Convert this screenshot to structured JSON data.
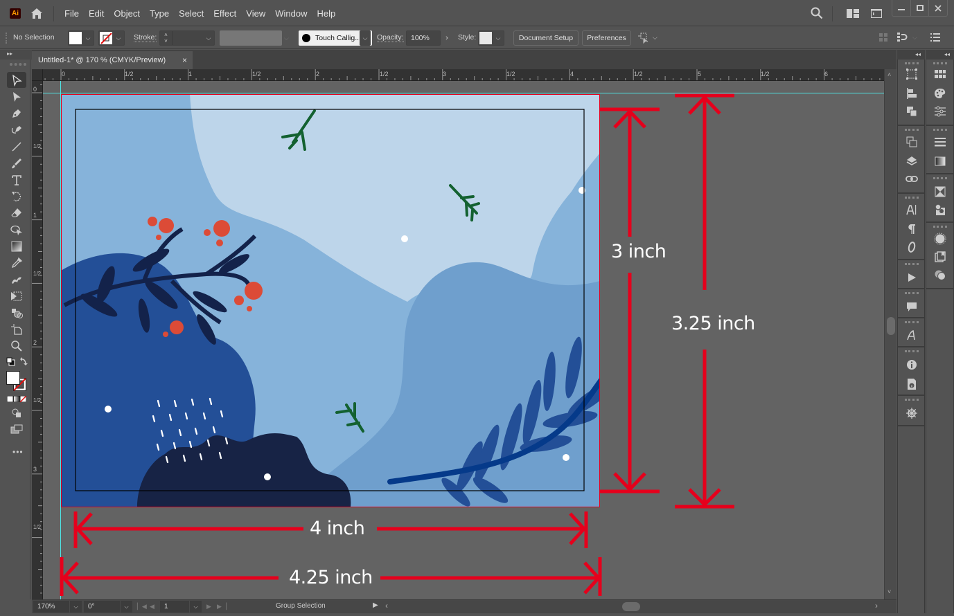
{
  "app": {
    "logo": "Ai",
    "menu": [
      "File",
      "Edit",
      "Object",
      "Type",
      "Select",
      "Effect",
      "View",
      "Window",
      "Help"
    ]
  },
  "control_bar": {
    "selection_status": "No Selection",
    "stroke_label": "Stroke:",
    "brush_name": "Touch Callig...",
    "opacity_label": "Opacity:",
    "opacity_value": "100%",
    "style_label": "Style:",
    "document_setup": "Document Setup",
    "preferences": "Preferences"
  },
  "document": {
    "tab_title": "Untitled-1* @ 170 % (CMYK/Preview)",
    "close_glyph": "×"
  },
  "rulers": {
    "top_labels": [
      "0",
      "1/2",
      "1",
      "1/2",
      "2",
      "1/2",
      "3",
      "1/2",
      "4",
      "1/2",
      "5",
      "1/2",
      "6"
    ],
    "left_labels": [
      "0",
      "1/2",
      "1",
      "1/2",
      "2",
      "1/2",
      "3",
      "1/2"
    ]
  },
  "annotations": {
    "height_trim": "3 inch",
    "height_bleed": "3.25 inch",
    "width_trim": "4 inch",
    "width_bleed": "4.25 inch",
    "color": "#e5001c"
  },
  "artwork_colors": {
    "sky_light": "#bdd5ea",
    "sky_mid": "#86b3da",
    "hill_mid": "#6f9fcd",
    "blob_blue": "#234f97",
    "blob_navy": "#172345",
    "berry_red": "#dc4b37",
    "leaf_green": "#136130",
    "leaf_dark": "#13224a",
    "fern_blue": "#234f97",
    "fern_stem": "#053a8a"
  },
  "status_bar": {
    "zoom": "170%",
    "rotation": "0°",
    "artboard_number": "1",
    "current_tool": "Group Selection"
  }
}
